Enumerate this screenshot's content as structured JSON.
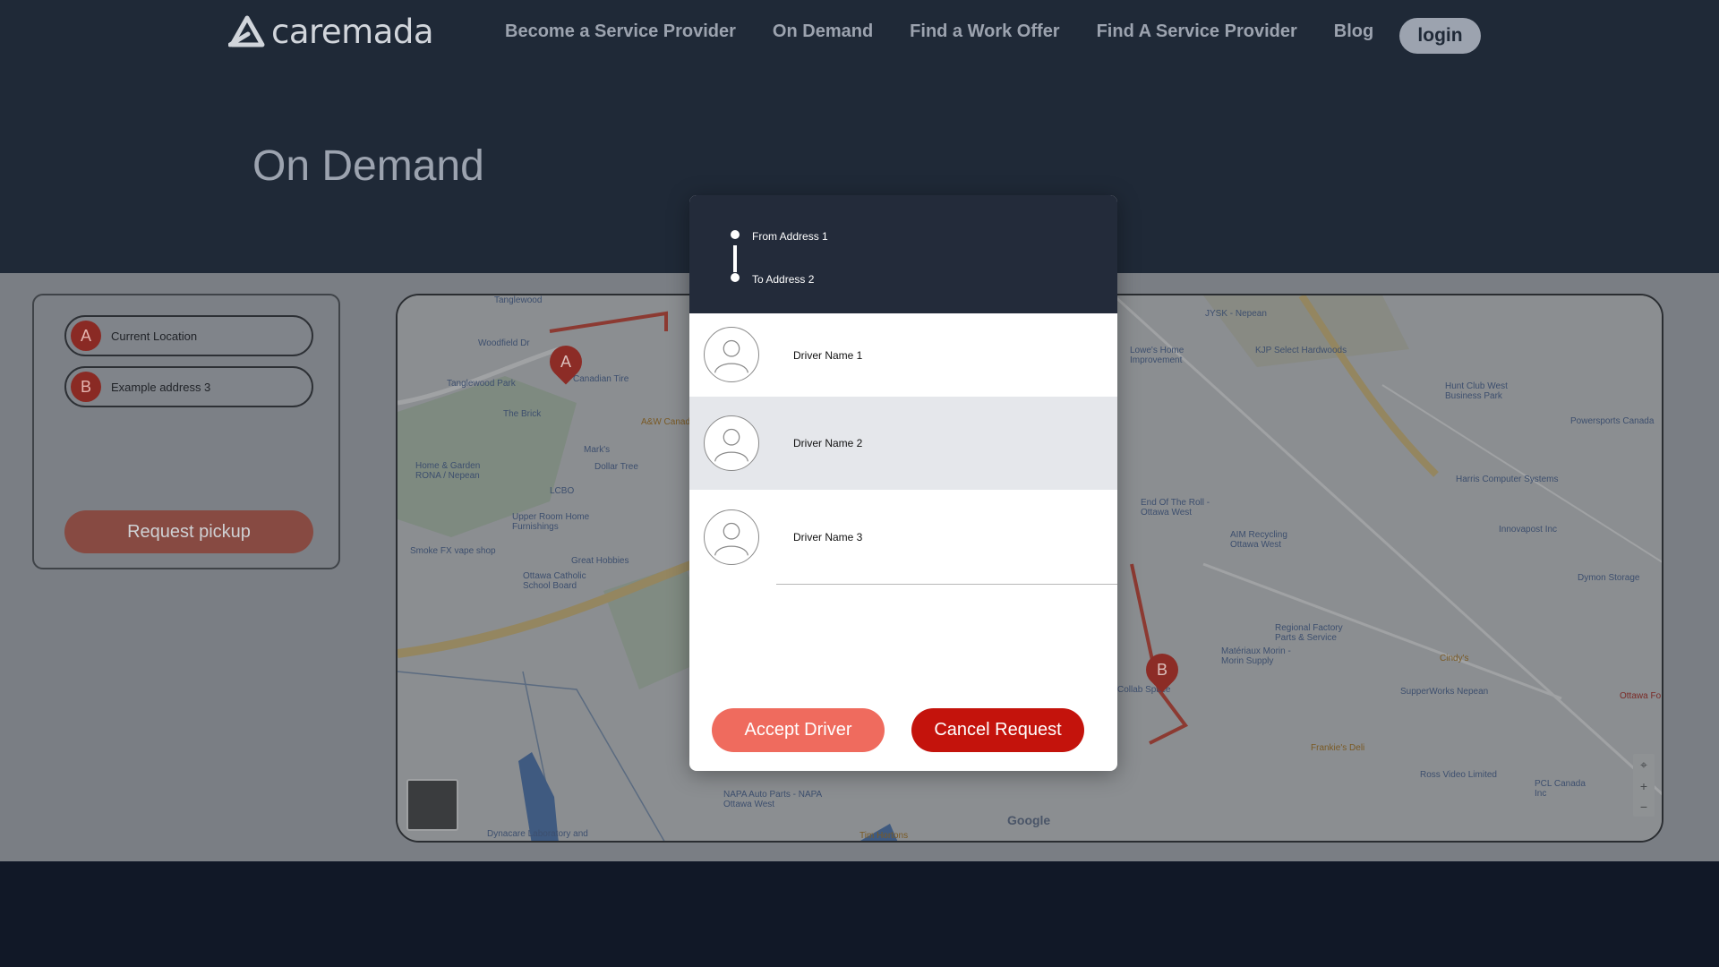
{
  "brand": {
    "name": "caremada"
  },
  "nav": {
    "items": [
      {
        "label": "Become a Service Provider"
      },
      {
        "label": "On Demand"
      },
      {
        "label": "Find a Work Offer"
      },
      {
        "label": "Find A Service Provider"
      },
      {
        "label": "Blog"
      }
    ],
    "login_label": "login"
  },
  "page": {
    "title": "On Demand"
  },
  "trip_form": {
    "from": {
      "badge": "A",
      "value": "Current Location"
    },
    "to": {
      "badge": "B",
      "value": "Example address 3"
    },
    "request_label": "Request pickup"
  },
  "map": {
    "labels": [
      "Tanglewood",
      "Woodfield Dr",
      "Tanglewood Park",
      "Canadian Tire",
      "The Brick",
      "A&W Canada",
      "Mark's",
      "Dollar Tree",
      "Home & Garden RONA / Nepean",
      "LCBO",
      "Upper Room Home Furnishings",
      "Smoke FX vape shop",
      "Great Hobbies",
      "Ottawa Catholic School Board",
      "NAPA Auto Parts - NAPA Ottawa West",
      "Dynacare Laboratory and",
      "Tim Hortons",
      "JYSK - Nepean",
      "Lowe's Home Improvement",
      "KJP Select Hardwoods",
      "Hunt Club West Business Park",
      "Powersports Canada",
      "Harris Computer Systems",
      "End Of The Roll - Ottawa West",
      "AIM Recycling Ottawa West",
      "Innovapost Inc",
      "Dymon Storage",
      "Regional Factory Parts & Service",
      "Matériaux Morin - Morin Supply",
      "Collab Space",
      "Cindy's",
      "SupperWorks Nepean",
      "Ottawa Fo",
      "Frankie's Deli",
      "Ross Video Limited",
      "PCL Canada Inc",
      "Google"
    ],
    "marker_a": "A",
    "marker_b": "B"
  },
  "modal": {
    "route": {
      "from": "From Address 1",
      "to": "To Address 2"
    },
    "drivers": [
      {
        "name": "Driver Name 1",
        "selected": false
      },
      {
        "name": "Driver Name 2",
        "selected": true
      },
      {
        "name": "Driver Name 3",
        "selected": false
      }
    ],
    "accept_label": "Accept Driver",
    "cancel_label": "Cancel Request"
  },
  "colors": {
    "header_bg": "#1f2937",
    "accent": "#ef6b5e",
    "danger": "#c4130c",
    "modal_header": "#232b3a",
    "selected_row": "#e5e7eb"
  }
}
